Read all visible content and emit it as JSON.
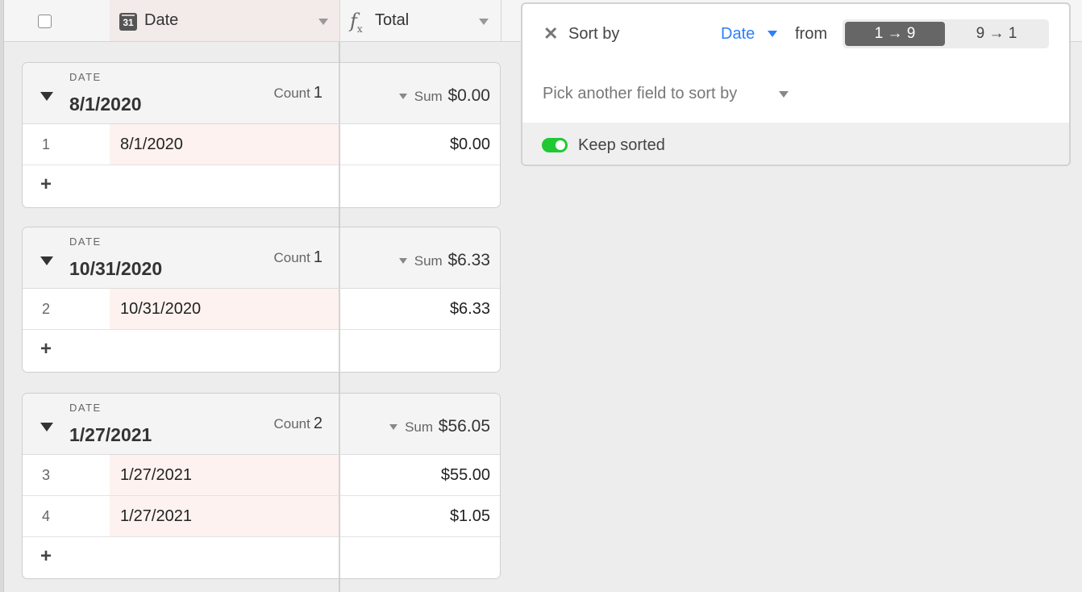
{
  "header": {
    "date_field": "Date",
    "calendar_day": "31",
    "total_field": "Total",
    "formula_icon": "fx"
  },
  "groups": [
    {
      "field": "DATE",
      "value": "8/1/2020",
      "count_label": "Count",
      "count": "1",
      "sum_label": "Sum",
      "sum": "$0.00",
      "rows": [
        {
          "num": "1",
          "date": "8/1/2020",
          "total": "$0.00"
        }
      ]
    },
    {
      "field": "DATE",
      "value": "10/31/2020",
      "count_label": "Count",
      "count": "1",
      "sum_label": "Sum",
      "sum": "$6.33",
      "rows": [
        {
          "num": "2",
          "date": "10/31/2020",
          "total": "$6.33"
        }
      ]
    },
    {
      "field": "DATE",
      "value": "1/27/2021",
      "count_label": "Count",
      "count": "2",
      "sum_label": "Sum",
      "sum": "$56.05",
      "rows": [
        {
          "num": "3",
          "date": "1/27/2021",
          "total": "$55.00"
        },
        {
          "num": "4",
          "date": "1/27/2021",
          "total": "$1.05"
        }
      ]
    }
  ],
  "add_label": "+",
  "sort": {
    "close_icon": "✕",
    "sort_by_label": "Sort by",
    "field": "Date",
    "from_label": "from",
    "asc_label": "1 → 9",
    "desc_label": "9 → 1",
    "pick_another": "Pick another field to sort by",
    "keep_sorted": "Keep sorted",
    "keep_sorted_on": true,
    "accent_color": "#2d7ff9",
    "toggle_color": "#20c933"
  }
}
